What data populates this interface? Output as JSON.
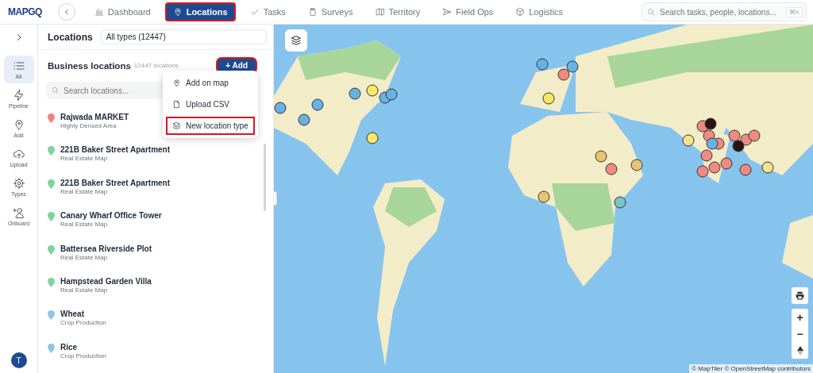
{
  "topbar": {
    "logo": "MAPGQ",
    "nav": [
      {
        "label": "Dashboard",
        "selected": false,
        "highlighted": false
      },
      {
        "label": "Locations",
        "selected": true,
        "highlighted": true
      },
      {
        "label": "Tasks",
        "selected": false,
        "highlighted": false
      },
      {
        "label": "Surveys",
        "selected": false,
        "highlighted": false
      },
      {
        "label": "Territory",
        "selected": false,
        "highlighted": false
      },
      {
        "label": "Field Ops",
        "selected": false,
        "highlighted": false
      },
      {
        "label": "Logistics",
        "selected": false,
        "highlighted": false
      }
    ],
    "search": {
      "placeholder": "Search tasks, people, locations...",
      "shortcut": "⌘K"
    }
  },
  "rail": {
    "items": [
      {
        "label": "All",
        "selected": true
      },
      {
        "label": "Pipeline",
        "selected": false
      },
      {
        "label": "Add",
        "selected": false
      },
      {
        "label": "Upload",
        "selected": false
      },
      {
        "label": "Types",
        "selected": false
      },
      {
        "label": "Onboard",
        "selected": false
      }
    ],
    "avatar": "T"
  },
  "panel": {
    "title": "Locations",
    "type_filter": "All types (12447)",
    "section_title": "Business locations",
    "count": "12447 locations",
    "add_button": {
      "label": "+ Add",
      "highlighted": true
    },
    "search": {
      "placeholder": "Search locations..."
    },
    "menu": [
      {
        "label": "Add on map",
        "highlighted": false
      },
      {
        "label": "Upload CSV",
        "highlighted": false
      },
      {
        "label": "New location type",
        "highlighted": true
      }
    ],
    "locations": [
      {
        "name": "Rajwada MARKET",
        "type": "Highly Densed Area",
        "color": "#f08080"
      },
      {
        "name": "221B Baker Street Apartment",
        "type": "Real Estate Map",
        "color": "#7fd39b"
      },
      {
        "name": "221B Baker Street Apartment",
        "type": "Real Estate Map",
        "color": "#7fd39b"
      },
      {
        "name": "Canary Wharf Office Tower",
        "type": "Real Estate Map",
        "color": "#7fd39b"
      },
      {
        "name": "Battersea Riverside Plot",
        "type": "Real Estate Map",
        "color": "#7fd39b"
      },
      {
        "name": "Hampstead Garden Villa",
        "type": "Real Estate Map",
        "color": "#7fd39b"
      },
      {
        "name": "Wheat",
        "type": "Crop Production",
        "color": "#8ec3e6"
      },
      {
        "name": "Rice",
        "type": "Crop Production",
        "color": "#8ec3e6"
      }
    ]
  },
  "map": {
    "zoom_in": "+",
    "zoom_out": "−",
    "attribution": "© MapTiler © OpenStreetMap contributors"
  }
}
